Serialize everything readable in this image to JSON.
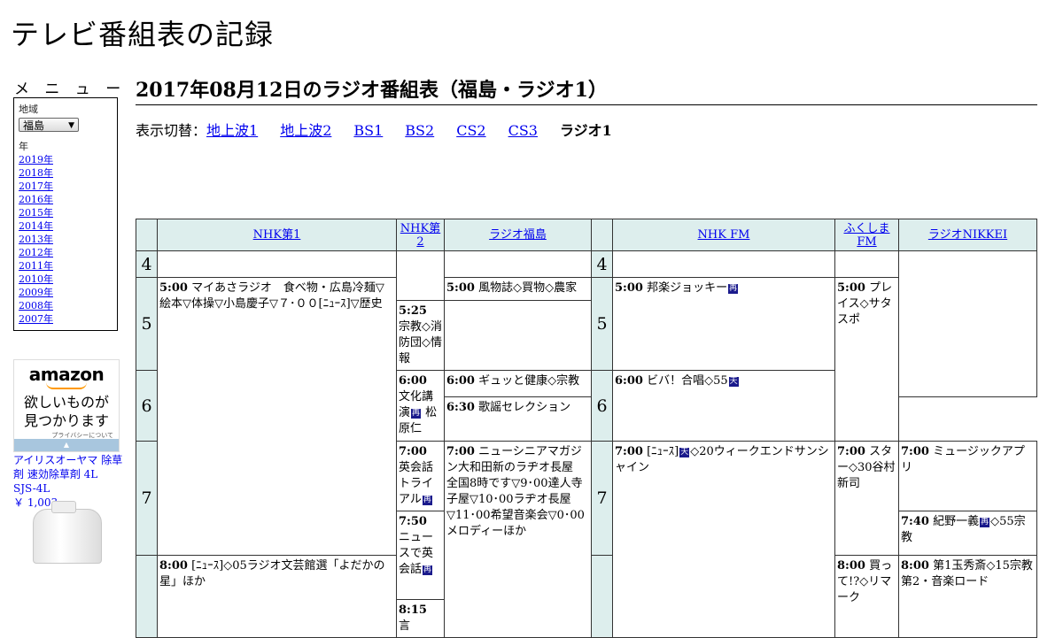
{
  "site": {
    "title": "テレビ番組表の記録"
  },
  "sidebar": {
    "menu_label": "メ ニ ュ ー",
    "region_label": "地域",
    "region_value": "福島",
    "year_label": "年",
    "years": [
      "2019年",
      "2018年",
      "2017年",
      "2016年",
      "2015年",
      "2014年",
      "2013年",
      "2012年",
      "2011年",
      "2010年",
      "2009年",
      "2008年",
      "2007年"
    ]
  },
  "ad": {
    "logo": "amazon",
    "message_line1": "欲しいものが",
    "message_line2": "見つかります",
    "privacy": "プライバシーについて",
    "product_name": "アイリスオーヤマ 除草剤 速効除草剤 4L SJS-4L",
    "price": "￥ 1,003"
  },
  "page": {
    "heading": "2017年08月12日のラジオ番組表（福島・ラジオ1）",
    "switch_label": "表示切替：",
    "switch_links": [
      "地上波1",
      "地上波2",
      "BS1",
      "BS2",
      "CS2",
      "CS3"
    ],
    "switch_current": "ラジオ1"
  },
  "grid": {
    "channels": [
      "NHK第1",
      "NHK第2",
      "ラジオ福島",
      "NHK FM",
      "ふくしまFM",
      "ラジオNIKKEI"
    ],
    "hours": [
      "4",
      "5",
      "6",
      "7"
    ],
    "programs": {
      "nhk1_500_time": "5:00",
      "nhk1_500_title": "マイあさラジオ　食べ物・広島冷麺▽絵本▽体操▽小島慶子▽７･００[ﾆｭｰｽ]▽歴史",
      "nhk1_800_time": "8:00",
      "nhk1_800_pre": "[ﾆｭｰｽ]",
      "nhk1_800_title": "◇05ラジオ文芸館選「よだかの星」ほか",
      "nhk2_600_time": "6:00",
      "nhk2_600_title": "文化講演",
      "nhk2_600_icon": "再",
      "nhk2_600_title2": "松原仁",
      "nhk2_700_time": "7:00",
      "nhk2_700_title": "英会話トライアル",
      "nhk2_700_icon": "再",
      "nhk2_750_time": "7:50",
      "nhk2_750_title": "ニュースで英会話",
      "nhk2_750_icon": "再",
      "nhk2_815_time": "8:15",
      "nhk2_815_title": "言",
      "rf_500_time": "5:00",
      "rf_500_title": "風物誌◇買物◇農家",
      "rf_525_time": "5:25",
      "rf_525_title": "宗教◇消防団◇情報",
      "rf_600_time": "6:00",
      "rf_600_title": "ギュッと健康◇宗教",
      "rf_630_time": "6:30",
      "rf_630_title": "歌謡セレクション",
      "rf_700_time": "7:00",
      "rf_700_title": "ニューシニアマガジン大和田新のラヂオ長屋　全国8時です▽9･00達人寺子屋▽10･00ラヂオ長屋▽11･00希望音楽会▽0･00メロディーほか",
      "fm_500_time": "5:00",
      "fm_500_title": "邦楽ジョッキー",
      "fm_500_icon": "再",
      "fm_600_time": "6:00",
      "fm_600_title": "ビバ！合唱◇55",
      "fm_600_icon": "天",
      "fm_700_time": "7:00",
      "fm_700_pre": "[ﾆｭｰｽ]",
      "fm_700_icon": "天",
      "fm_700_title": "◇20ウィークエンドサンシャイン",
      "ffm_500_time": "5:00",
      "ffm_500_title": "プレイス◇サタスポ",
      "ffm_700_time": "7:00",
      "ffm_700_title": "スター◇30谷村新司",
      "ffm_800_time": "8:00",
      "ffm_800_title": "買って!?◇リマーク",
      "nk_700_time": "7:00",
      "nk_700_title": "ミュージックアプリ",
      "nk_740_time": "7:40",
      "nk_740_title": "紀野一義",
      "nk_740_icon": "再",
      "nk_740_title2": "◇55宗教",
      "nk_800_time": "8:00",
      "nk_800_title": "第1玉秀斎◇15宗教第2・音楽ロード"
    }
  }
}
